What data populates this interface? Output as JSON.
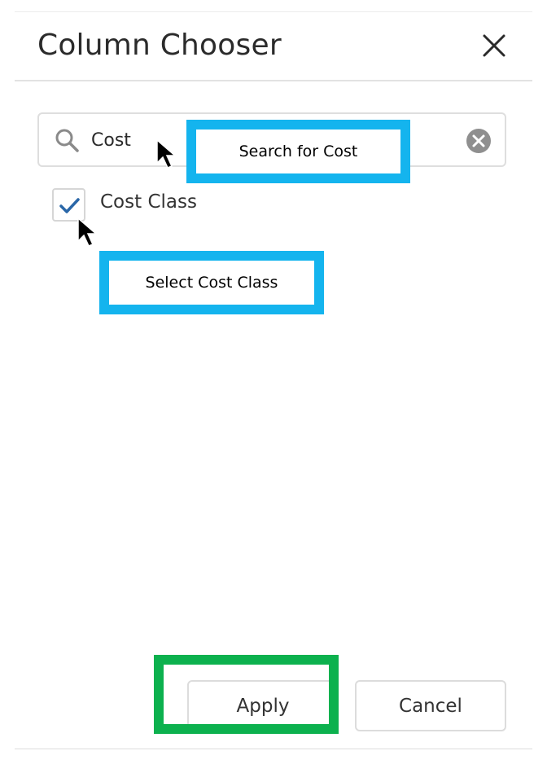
{
  "dialog": {
    "title": "Column Chooser",
    "close_icon": "close-icon"
  },
  "search": {
    "value": "Cost",
    "placeholder": "",
    "search_icon": "search-icon",
    "clear_icon": "clear-circle-icon"
  },
  "options": [
    {
      "label": "Cost Class",
      "checked": true
    }
  ],
  "footer": {
    "apply_label": "Apply",
    "cancel_label": "Cancel"
  },
  "annotations": {
    "search_callout": "Search for Cost",
    "select_callout": "Select Cost Class"
  },
  "colors": {
    "callout_blue": "#14b4ee",
    "callout_green": "#0cb14e",
    "check_blue": "#2a67a8"
  }
}
